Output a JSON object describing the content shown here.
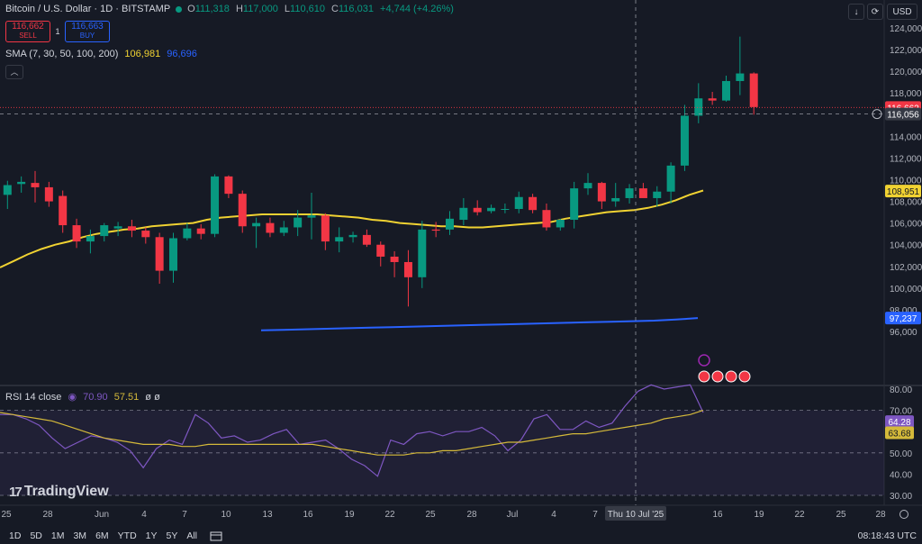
{
  "header": {
    "symbol": "Bitcoin / U.S. Dollar · 1D · BITSTAMP",
    "open_label": "O",
    "open": "111,318",
    "high_label": "H",
    "high": "117,000",
    "low_label": "L",
    "low": "110,610",
    "close_label": "C",
    "close": "116,031",
    "change": "+4,744 (+4.26%)"
  },
  "trade": {
    "sell_price": "116,662",
    "sell_label": "SELL",
    "spread": "1",
    "buy_price": "116,663",
    "buy_label": "BUY"
  },
  "sma_label": {
    "name": "SMA (7, 30, 50, 100, 200)",
    "v1": "106,981",
    "v2": "96,696"
  },
  "rsi_label": {
    "name": "RSI 14 close",
    "v1": "70.90",
    "v2": "57.51",
    "extra": "ø ø"
  },
  "brand": "TradingView",
  "toolbar_right": {
    "currency": "USD"
  },
  "bottom": {
    "timeframes": [
      "1D",
      "5D",
      "1M",
      "3M",
      "6M",
      "YTD",
      "1Y",
      "5Y",
      "All"
    ],
    "clock": "08:18:43 UTC"
  },
  "colors": {
    "up": "#089981",
    "down": "#f23645",
    "sma_yellow": "#f0d232",
    "sma_blue": "#2962ff",
    "rsi": "#7e57c2",
    "rsi_ma": "#d4b93a"
  },
  "chart_data": {
    "type": "candlestick",
    "price_axis": {
      "ticks": [
        "124,000",
        "122,000",
        "120,000",
        "118,000",
        "116,000",
        "114,000",
        "112,000",
        "110,000",
        "108,000",
        "106,000",
        "104,000",
        "102,000",
        "100,000",
        "98,000",
        "96,000"
      ],
      "ylim": [
        96000,
        125000
      ]
    },
    "price_labels": {
      "ask": "116,662",
      "crosshair": "116,056",
      "sma_yellow": "108,951",
      "sma_blue": "97,237"
    },
    "x_axis": {
      "ticks": [
        "25",
        "28",
        "Jun",
        "4",
        "7",
        "10",
        "13",
        "16",
        "19",
        "22",
        "25",
        "28",
        "Jul",
        "4",
        "7",
        "Thu 10 Jul '25",
        "16",
        "19",
        "22",
        "25",
        "28"
      ]
    },
    "candles": [
      {
        "o": 108600,
        "h": 109900,
        "l": 107300,
        "c": 109500
      },
      {
        "o": 109600,
        "h": 110300,
        "l": 108800,
        "c": 109800
      },
      {
        "o": 109700,
        "h": 110800,
        "l": 107900,
        "c": 109300
      },
      {
        "o": 109300,
        "h": 109800,
        "l": 107500,
        "c": 108000
      },
      {
        "o": 108500,
        "h": 109000,
        "l": 105100,
        "c": 105800
      },
      {
        "o": 105800,
        "h": 106400,
        "l": 103700,
        "c": 104300
      },
      {
        "o": 104300,
        "h": 105400,
        "l": 103200,
        "c": 104800
      },
      {
        "o": 104800,
        "h": 106000,
        "l": 104300,
        "c": 105800
      },
      {
        "o": 105500,
        "h": 106100,
        "l": 104800,
        "c": 105700
      },
      {
        "o": 105700,
        "h": 106300,
        "l": 104700,
        "c": 105300
      },
      {
        "o": 105300,
        "h": 105600,
        "l": 104100,
        "c": 104700
      },
      {
        "o": 104700,
        "h": 105100,
        "l": 100400,
        "c": 101600
      },
      {
        "o": 101600,
        "h": 105100,
        "l": 100500,
        "c": 104600
      },
      {
        "o": 104600,
        "h": 106000,
        "l": 104400,
        "c": 105500
      },
      {
        "o": 105500,
        "h": 105900,
        "l": 104500,
        "c": 105000
      },
      {
        "o": 105000,
        "h": 110500,
        "l": 104700,
        "c": 110300
      },
      {
        "o": 110300,
        "h": 110400,
        "l": 108300,
        "c": 108700
      },
      {
        "o": 108700,
        "h": 109000,
        "l": 105100,
        "c": 105700
      },
      {
        "o": 105700,
        "h": 106500,
        "l": 103700,
        "c": 106000
      },
      {
        "o": 106000,
        "h": 106500,
        "l": 104700,
        "c": 105100
      },
      {
        "o": 105100,
        "h": 106200,
        "l": 104800,
        "c": 105600
      },
      {
        "o": 105600,
        "h": 107200,
        "l": 104800,
        "c": 106500
      },
      {
        "o": 106500,
        "h": 108800,
        "l": 104500,
        "c": 106700
      },
      {
        "o": 106700,
        "h": 106900,
        "l": 103500,
        "c": 104300
      },
      {
        "o": 104300,
        "h": 105600,
        "l": 103300,
        "c": 104700
      },
      {
        "o": 104700,
        "h": 105200,
        "l": 104200,
        "c": 104900
      },
      {
        "o": 104900,
        "h": 105400,
        "l": 103800,
        "c": 104000
      },
      {
        "o": 104000,
        "h": 104300,
        "l": 102000,
        "c": 102900
      },
      {
        "o": 102900,
        "h": 103400,
        "l": 101000,
        "c": 102400
      },
      {
        "o": 102400,
        "h": 103500,
        "l": 98300,
        "c": 101000
      },
      {
        "o": 101000,
        "h": 106200,
        "l": 100000,
        "c": 105400
      },
      {
        "o": 105400,
        "h": 106100,
        "l": 104700,
        "c": 105300
      },
      {
        "o": 105400,
        "h": 107100,
        "l": 104900,
        "c": 106400
      },
      {
        "o": 106300,
        "h": 108300,
        "l": 105800,
        "c": 107400
      },
      {
        "o": 107400,
        "h": 108100,
        "l": 106700,
        "c": 107000
      },
      {
        "o": 107100,
        "h": 107700,
        "l": 106900,
        "c": 107400
      },
      {
        "o": 107300,
        "h": 107800,
        "l": 106900,
        "c": 107300
      },
      {
        "o": 107300,
        "h": 108900,
        "l": 106900,
        "c": 108400
      },
      {
        "o": 108400,
        "h": 108700,
        "l": 106900,
        "c": 107200
      },
      {
        "o": 107200,
        "h": 107800,
        "l": 105300,
        "c": 105600
      },
      {
        "o": 105600,
        "h": 106400,
        "l": 105300,
        "c": 106300
      },
      {
        "o": 106300,
        "h": 109800,
        "l": 105500,
        "c": 109200
      },
      {
        "o": 109200,
        "h": 110600,
        "l": 108600,
        "c": 109700
      },
      {
        "o": 109700,
        "h": 109800,
        "l": 107300,
        "c": 108000
      },
      {
        "o": 108000,
        "h": 109700,
        "l": 107500,
        "c": 108300
      },
      {
        "o": 108300,
        "h": 109600,
        "l": 107800,
        "c": 109200
      },
      {
        "o": 109200,
        "h": 109700,
        "l": 108500,
        "c": 108300
      },
      {
        "o": 108300,
        "h": 109400,
        "l": 107500,
        "c": 108900
      },
      {
        "o": 108900,
        "h": 111600,
        "l": 107800,
        "c": 111300
      },
      {
        "o": 111300,
        "h": 116900,
        "l": 110800,
        "c": 115900
      },
      {
        "o": 115900,
        "h": 118900,
        "l": 115200,
        "c": 117500
      },
      {
        "o": 117500,
        "h": 118100,
        "l": 116900,
        "c": 117300
      },
      {
        "o": 117300,
        "h": 119600,
        "l": 117200,
        "c": 119100
      },
      {
        "o": 119100,
        "h": 123200,
        "l": 117800,
        "c": 119800
      },
      {
        "o": 119800,
        "h": 119900,
        "l": 116000,
        "c": 116700
      }
    ],
    "sma_yellow": [
      101900,
      102500,
      103100,
      103600,
      104000,
      104300,
      104700,
      105000,
      105200,
      105400,
      105500,
      105700,
      105800,
      105900,
      106000,
      106300,
      106500,
      106600,
      106700,
      106800,
      106800,
      106800,
      106800,
      106800,
      106700,
      106600,
      106500,
      106300,
      106200,
      106000,
      105900,
      105800,
      105700,
      105700,
      105600,
      105600,
      105700,
      105800,
      105900,
      106000,
      106100,
      106400,
      106600,
      106800,
      107000,
      107100,
      107200,
      107400,
      107700,
      108100,
      108600,
      109000
    ],
    "sma_blue": [
      96100,
      96150,
      96200,
      96250,
      96300,
      96350,
      96400,
      96450,
      96500,
      96550,
      96600,
      96650,
      96700,
      96750,
      96800,
      96850,
      96900,
      96950,
      97000,
      97100,
      97237
    ],
    "rsi": [
      68,
      68,
      66,
      63,
      57,
      52,
      55,
      58,
      57,
      55,
      51,
      43,
      52,
      56,
      54,
      68,
      64,
      57,
      58,
      55,
      56,
      59,
      61,
      54,
      55,
      56,
      52,
      47,
      44,
      39,
      56,
      54,
      59,
      60,
      58,
      60,
      60,
      62,
      58,
      51,
      56,
      66,
      68,
      61,
      61,
      65,
      62,
      64,
      72,
      79,
      82,
      80,
      81,
      82,
      69
    ],
    "rsi_ma": [
      69,
      68,
      67,
      66,
      65,
      63,
      61,
      59,
      57,
      56,
      55,
      54,
      54,
      54,
      53,
      53,
      54,
      54,
      54,
      54,
      54,
      54,
      54,
      54,
      54,
      53,
      52,
      51,
      50,
      49,
      49,
      49,
      50,
      50,
      51,
      51,
      52,
      53,
      54,
      55,
      55,
      56,
      57,
      58,
      59,
      59,
      60,
      61,
      62,
      63,
      64,
      66,
      67,
      68,
      70
    ],
    "rsi_axis": {
      "ticks": [
        "80.00",
        "70.00",
        "60.00",
        "50.00",
        "40.00",
        "30.00"
      ],
      "labels": [
        "64.28",
        "63.68"
      ]
    }
  }
}
